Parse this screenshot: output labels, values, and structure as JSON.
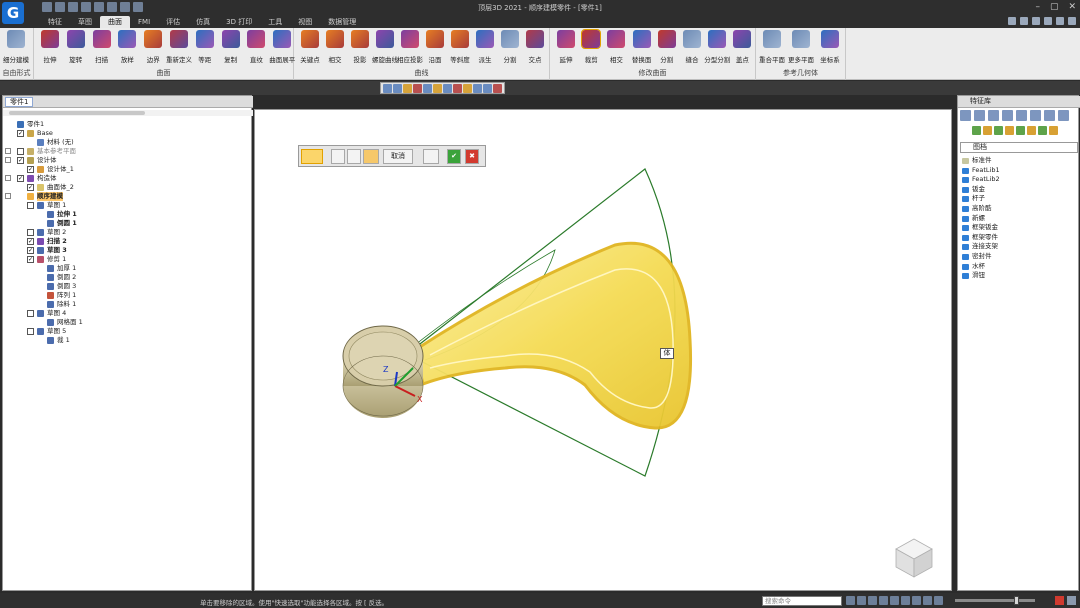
{
  "app": {
    "logo_letter": "G",
    "window_title": "顶层3D 2021 - 顺序建模零件 - [零件1]",
    "window_controls": [
      "–",
      "▢",
      "✕"
    ]
  },
  "menu_tabs": [
    "特征",
    "草图",
    "曲面",
    "FMI",
    "评估",
    "仿真",
    "3D 打印",
    "工具",
    "视图",
    "数据管理"
  ],
  "active_tab_index": 2,
  "ribbon": {
    "groups": [
      {
        "label": "自由形式",
        "buttons": [
          {
            "label": "细分建模",
            "icon": "subdivide-icon",
            "color": "c6"
          }
        ]
      },
      {
        "label": "曲面",
        "buttons": [
          {
            "label": "拉伸",
            "icon": "extrude-icon",
            "color": "c1"
          },
          {
            "label": "旋转",
            "icon": "revolve-icon",
            "color": "c2"
          },
          {
            "label": "扫描",
            "icon": "sweep-icon",
            "color": "c3"
          },
          {
            "label": "放样",
            "icon": "loft-icon",
            "color": "c4"
          },
          {
            "label": "边界",
            "icon": "boundary-icon",
            "color": "c5"
          },
          {
            "label": "重新定义",
            "icon": "redefine-icon",
            "color": "c7"
          },
          {
            "label": "等距",
            "icon": "offset-icon",
            "color": "c4"
          },
          {
            "label": "复制",
            "icon": "copy-icon",
            "color": "c2"
          },
          {
            "label": "直纹",
            "icon": "ruled-icon",
            "color": "c3"
          },
          {
            "label": "曲面展平",
            "icon": "flatten-icon",
            "color": "c4"
          }
        ]
      },
      {
        "label": "曲线",
        "buttons": [
          {
            "label": "关键点",
            "icon": "keypoint-icon",
            "color": "c5"
          },
          {
            "label": "相交",
            "icon": "intersect-icon",
            "color": "c5"
          },
          {
            "label": "投影",
            "icon": "project-icon",
            "color": "c5"
          },
          {
            "label": "螺旋曲线",
            "icon": "helix-icon",
            "color": "c2"
          },
          {
            "label": "相应投影",
            "icon": "corr-project-icon",
            "color": "c3"
          },
          {
            "label": "沿面",
            "icon": "along-face-icon",
            "color": "c5"
          },
          {
            "label": "等斜度",
            "icon": "isocline-icon",
            "color": "c5"
          },
          {
            "label": "派生",
            "icon": "derive-icon",
            "color": "c4"
          },
          {
            "label": "分割",
            "icon": "split-curve-icon",
            "color": "c6"
          },
          {
            "label": "交点",
            "icon": "intersect-point-icon",
            "color": "c7"
          }
        ]
      },
      {
        "label": "修改曲面",
        "buttons": [
          {
            "label": "延伸",
            "icon": "extend-icon",
            "color": "c3"
          },
          {
            "label": "裁剪",
            "icon": "trim-icon",
            "color": "c1",
            "active": true
          },
          {
            "label": "相交",
            "icon": "surface-intersect-icon",
            "color": "c3"
          },
          {
            "label": "替换面",
            "icon": "replace-face-icon",
            "color": "c4"
          },
          {
            "label": "分割",
            "icon": "split-icon",
            "color": "c1"
          },
          {
            "label": "缝合",
            "icon": "stitch-icon",
            "color": "c6"
          },
          {
            "label": "分型分割",
            "icon": "parting-split-icon",
            "color": "c4"
          },
          {
            "label": "盖点",
            "icon": "cap-point-icon",
            "color": "c2"
          }
        ]
      },
      {
        "label": "参考几何体",
        "buttons": [
          {
            "label": "重合平面",
            "icon": "coincident-plane-icon",
            "color": "c6"
          },
          {
            "label": "更多平面",
            "icon": "more-planes-icon",
            "color": "c6"
          },
          {
            "label": "坐标系",
            "icon": "coord-system-icon",
            "color": "c4"
          }
        ]
      }
    ]
  },
  "left_panel": {
    "tab_label": "零件1",
    "tree": [
      {
        "label": "零件1",
        "indent": 0,
        "icon": "#3a6fb6"
      },
      {
        "label": "Base",
        "indent": 1,
        "check": true,
        "icon": "#c9a64a"
      },
      {
        "label": "材料 (无)",
        "indent": 2,
        "icon": "#5a7fbf"
      },
      {
        "label": "基本参考平面",
        "indent": 1,
        "toggle": true,
        "check": false,
        "icon": "#c6b068",
        "muted": true
      },
      {
        "label": "设计体",
        "indent": 1,
        "toggle": true,
        "check": true,
        "icon": "#b4a050"
      },
      {
        "label": "设计体_1",
        "indent": 2,
        "check": true,
        "icon": "#d89b3b"
      },
      {
        "label": "构造体",
        "indent": 1,
        "toggle": true,
        "check": true,
        "icon": "#7e4bb0"
      },
      {
        "label": "曲面体_2",
        "indent": 2,
        "check": true,
        "icon": "#d9c46a"
      },
      {
        "label": "顺序建模",
        "indent": 1,
        "toggle": true,
        "icon": "#f0b040",
        "highlight": true,
        "bold": true
      },
      {
        "label": "草图 1",
        "indent": 2,
        "check": false,
        "icon": "#4b6cad"
      },
      {
        "label": "拉伸 1",
        "indent": 3,
        "icon": "#4b6cad",
        "bold": true
      },
      {
        "label": "倒圆 1",
        "indent": 3,
        "icon": "#4b6cad",
        "bold": true
      },
      {
        "label": "草图 2",
        "indent": 2,
        "check": false,
        "icon": "#4b6cad"
      },
      {
        "label": "扫描 2",
        "indent": 2,
        "check": true,
        "icon": "#7a4ab0",
        "bold": true
      },
      {
        "label": "草图 3",
        "indent": 2,
        "check": true,
        "icon": "#4b6cad",
        "bold": true
      },
      {
        "label": "修剪 1",
        "indent": 2,
        "check": true,
        "icon": "#b8506a"
      },
      {
        "label": "加厚 1",
        "indent": 3,
        "icon": "#4b6cad"
      },
      {
        "label": "倒圆 2",
        "indent": 3,
        "icon": "#4b6cad"
      },
      {
        "label": "倒圆 3",
        "indent": 3,
        "icon": "#4b6cad"
      },
      {
        "label": "阵列 1",
        "indent": 3,
        "icon": "#c4533b"
      },
      {
        "label": "除料 1",
        "indent": 3,
        "icon": "#4b6cad"
      },
      {
        "label": "草图 4",
        "indent": 2,
        "check": false,
        "icon": "#4b6cad"
      },
      {
        "label": "网格面 1",
        "indent": 3,
        "icon": "#4b6cad"
      },
      {
        "label": "草图 5",
        "indent": 2,
        "check": false,
        "icon": "#4b6cad"
      },
      {
        "label": "裁 1",
        "indent": 3,
        "icon": "#4b6cad"
      }
    ]
  },
  "float_toolbar": {
    "cancel_label": "取消",
    "hint_box": "体"
  },
  "viewport": {
    "axis_z": "Z",
    "axis_x": "X"
  },
  "right_panel": {
    "title": "特征库",
    "select_value": "图档",
    "items": [
      "标准件",
      "FeatLib1",
      "FeatLib2",
      "钣金",
      "杆子",
      "高阶酷",
      "新螺",
      "框架钣金",
      "框架零件",
      "连接支架",
      "密封件",
      "水杯",
      "滑钮"
    ]
  },
  "status": {
    "text": "单击要移除的区域。使用\"快速选取\"功能选择各区域。按 [ 反选。",
    "cmd_placeholder": "搜索命令",
    "zoom_fraction": 0.78
  },
  "colors": {
    "accent": "#e2a100",
    "surface_yellow": "#f5dc55",
    "wire_green": "#2a7a2a",
    "boss_tan": "#d4c9a0"
  }
}
